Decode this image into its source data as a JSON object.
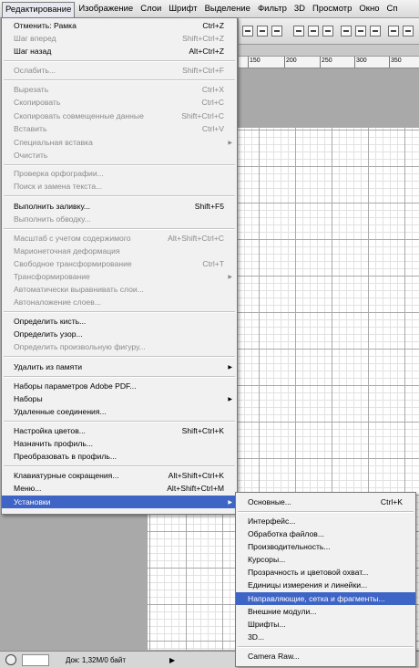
{
  "menubar": {
    "items": [
      "Редактирование",
      "Изображение",
      "Слои",
      "Шрифт",
      "Выделение",
      "Фильтр",
      "3D",
      "Просмотр",
      "Окно",
      "Сп"
    ]
  },
  "ruler": {
    "labels": [
      "150",
      "200",
      "250",
      "300",
      "350"
    ]
  },
  "status": {
    "doc_info": "Док: 1,32M/0 байт",
    "arrow": "▶"
  },
  "edit_menu": {
    "undo": {
      "label": "Отменить: Рамка",
      "shortcut": "Ctrl+Z"
    },
    "step_forward": {
      "label": "Шаг вперед",
      "shortcut": "Shift+Ctrl+Z"
    },
    "step_back": {
      "label": "Шаг назад",
      "shortcut": "Alt+Ctrl+Z"
    },
    "fade": {
      "label": "Ослабить...",
      "shortcut": "Shift+Ctrl+F"
    },
    "cut": {
      "label": "Вырезать",
      "shortcut": "Ctrl+X"
    },
    "copy": {
      "label": "Скопировать",
      "shortcut": "Ctrl+C"
    },
    "copy_merged": {
      "label": "Скопировать совмещенные данные",
      "shortcut": "Shift+Ctrl+C"
    },
    "paste": {
      "label": "Вставить",
      "shortcut": "Ctrl+V"
    },
    "paste_special": {
      "label": "Специальная вставка"
    },
    "clear": {
      "label": "Очистить"
    },
    "check_spelling": {
      "label": "Проверка орфографии..."
    },
    "find_replace": {
      "label": "Поиск и замена текста..."
    },
    "fill": {
      "label": "Выполнить заливку...",
      "shortcut": "Shift+F5"
    },
    "stroke": {
      "label": "Выполнить обводку..."
    },
    "content_aware_scale": {
      "label": "Масштаб с учетом содержимого",
      "shortcut": "Alt+Shift+Ctrl+C"
    },
    "puppet_warp": {
      "label": "Марионеточная деформация"
    },
    "free_transform": {
      "label": "Свободное трансформирование",
      "shortcut": "Ctrl+T"
    },
    "transform": {
      "label": "Трансформирование"
    },
    "auto_align": {
      "label": "Автоматически выравнивать слои..."
    },
    "auto_blend": {
      "label": "Автоналожение слоев..."
    },
    "define_brush": {
      "label": "Определить кисть..."
    },
    "define_pattern": {
      "label": "Определить узор..."
    },
    "define_shape": {
      "label": "Определить произвольную фигуру..."
    },
    "purge": {
      "label": "Удалить из памяти"
    },
    "pdf_presets": {
      "label": "Наборы параметров Adobe PDF..."
    },
    "presets": {
      "label": "Наборы"
    },
    "remote": {
      "label": "Удаленные соединения..."
    },
    "color_settings": {
      "label": "Настройка цветов...",
      "shortcut": "Shift+Ctrl+K"
    },
    "assign_profile": {
      "label": "Назначить профиль..."
    },
    "convert_profile": {
      "label": "Преобразовать в профиль..."
    },
    "shortcuts": {
      "label": "Клавиатурные сокращения...",
      "shortcut": "Alt+Shift+Ctrl+K"
    },
    "menus": {
      "label": "Меню...",
      "shortcut": "Alt+Shift+Ctrl+M"
    },
    "preferences": {
      "label": "Установки"
    }
  },
  "prefs_submenu": {
    "general": {
      "label": "Основные...",
      "shortcut": "Ctrl+K"
    },
    "interface": {
      "label": "Интерфейс..."
    },
    "file_handling": {
      "label": "Обработка файлов..."
    },
    "performance": {
      "label": "Производительность..."
    },
    "cursors": {
      "label": "Курсоры..."
    },
    "transparency": {
      "label": "Прозрачность и цветовой охват..."
    },
    "units": {
      "label": "Единицы измерения и линейки..."
    },
    "guides": {
      "label": "Направляющие, сетка и фрагменты..."
    },
    "plugins": {
      "label": "Внешние модули..."
    },
    "type": {
      "label": "Шрифты..."
    },
    "three_d": {
      "label": "3D..."
    },
    "camera_raw": {
      "label": "Camera Raw..."
    }
  }
}
